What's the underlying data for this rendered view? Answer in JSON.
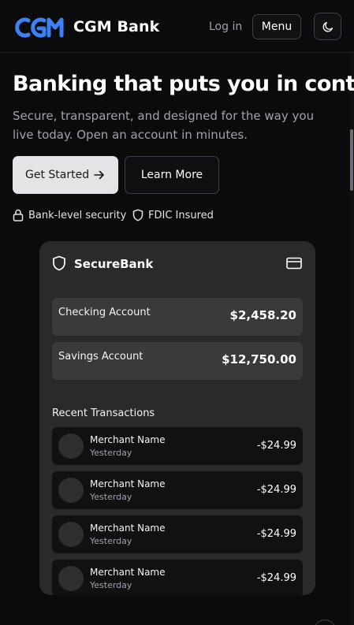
{
  "header": {
    "logo_mark_text": "CGM",
    "brand": "CGM Bank",
    "login": "Log in",
    "menu": "Menu",
    "theme_icon": "moon-icon"
  },
  "hero": {
    "title": "Banking that puts you in control",
    "subtitle": "Secure, transparent, and designed for the way you live today. Open an account in minutes.",
    "primary_cta": "Get Started",
    "secondary_cta": "Learn More",
    "features": [
      {
        "label": "Bank-level security",
        "icon": "lock-icon"
      },
      {
        "label": "FDIC Insured",
        "icon": "shield-icon"
      }
    ]
  },
  "card": {
    "title": "SecureBank",
    "accounts": [
      {
        "name": "Checking Account",
        "balance": "$2,458.20"
      },
      {
        "name": "Savings Account",
        "balance": "$12,750.00"
      }
    ],
    "transactions_heading": "Recent Transactions",
    "transactions": [
      {
        "merchant": "Merchant Name",
        "date": "Yesterday",
        "amount": "-$24.99"
      },
      {
        "merchant": "Merchant Name",
        "date": "Yesterday",
        "amount": "-$24.99"
      },
      {
        "merchant": "Merchant Name",
        "date": "Yesterday",
        "amount": "-$24.99"
      },
      {
        "merchant": "Merchant Name",
        "date": "Yesterday",
        "amount": "-$24.99"
      }
    ]
  },
  "colors": {
    "background": "#0b0b0c",
    "brand_blue": "#3b82f6",
    "card": "#2a2a2c",
    "primary_button": "#e4e4e7"
  }
}
